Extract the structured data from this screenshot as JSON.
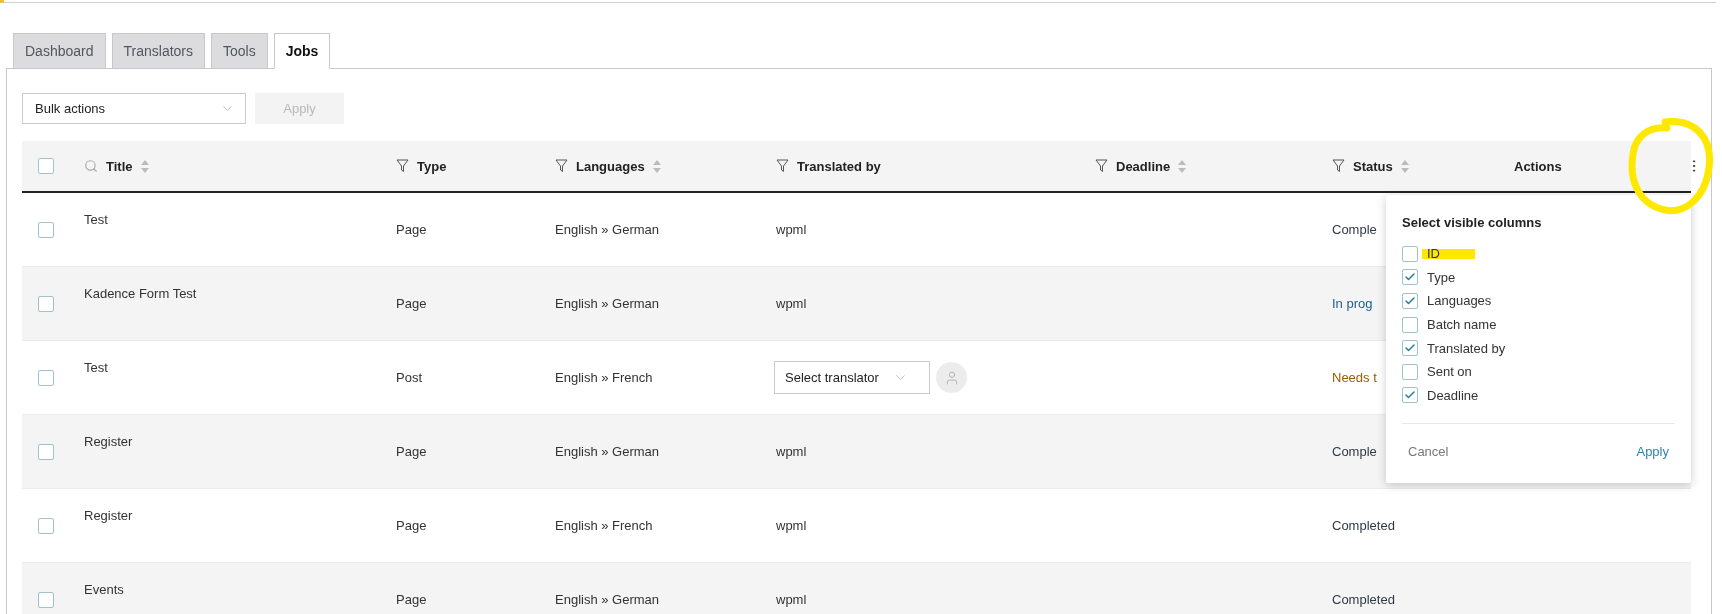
{
  "tabs": [
    {
      "label": "Dashboard",
      "selected": false
    },
    {
      "label": "Translators",
      "selected": false
    },
    {
      "label": "Tools",
      "selected": false
    },
    {
      "label": "Jobs",
      "selected": true
    }
  ],
  "toolbar": {
    "bulk_actions": {
      "value": "Bulk actions"
    },
    "apply_button": {
      "label": "Apply",
      "disabled": true
    }
  },
  "table": {
    "select_all_checked": false,
    "columns": [
      {
        "label": "Title",
        "kind": "search",
        "sortable": true
      },
      {
        "label": "Type",
        "kind": "filter",
        "sortable": false
      },
      {
        "label": "Languages",
        "kind": "filter",
        "sortable": true
      },
      {
        "label": "Translated by",
        "kind": "filter",
        "sortable": false
      },
      {
        "label": "Deadline",
        "kind": "filter",
        "sortable": true
      },
      {
        "label": "Status",
        "kind": "filter",
        "sortable": true
      },
      {
        "label": "Actions",
        "kind": "plain",
        "sortable": false
      }
    ],
    "column_menu_button": {
      "annotated": true
    },
    "rows": [
      {
        "checked": false,
        "title": "Test",
        "type": "Page",
        "languages": "English » German",
        "translator": {
          "kind": "text",
          "value": "wpml"
        },
        "status": {
          "text": "Comple",
          "kind": "completed"
        }
      },
      {
        "checked": false,
        "title": "Kadence Form Test",
        "type": "Page",
        "languages": "English » German",
        "translator": {
          "kind": "text",
          "value": "wpml"
        },
        "status": {
          "text": "In prog",
          "kind": "in_progress"
        }
      },
      {
        "checked": false,
        "title": "Test",
        "type": "Post",
        "languages": "English » French",
        "translator": {
          "kind": "select",
          "value": "Select translator"
        },
        "status": {
          "text": "Needs t",
          "kind": "needs_translation"
        }
      },
      {
        "checked": false,
        "title": "Register",
        "type": "Page",
        "languages": "English » German",
        "translator": {
          "kind": "text",
          "value": "wpml"
        },
        "status": {
          "text": "Comple",
          "kind": "completed"
        }
      },
      {
        "checked": false,
        "title": "Register",
        "type": "Page",
        "languages": "English » French",
        "translator": {
          "kind": "text",
          "value": "wpml"
        },
        "status": {
          "text": "Completed",
          "kind": "completed"
        }
      },
      {
        "checked": false,
        "title": "Events",
        "type": "Page",
        "languages": "English » German",
        "translator": {
          "kind": "text",
          "value": "wpml"
        },
        "status": {
          "text": "Completed",
          "kind": "completed"
        }
      }
    ]
  },
  "column_picker": {
    "title": "Select visible columns",
    "options": [
      {
        "label": "ID",
        "checked": false,
        "highlighted": true
      },
      {
        "label": "Type",
        "checked": true,
        "highlighted": false
      },
      {
        "label": "Languages",
        "checked": true,
        "highlighted": false
      },
      {
        "label": "Batch name",
        "checked": false,
        "highlighted": false
      },
      {
        "label": "Translated by",
        "checked": true,
        "highlighted": false
      },
      {
        "label": "Sent on",
        "checked": false,
        "highlighted": false
      },
      {
        "label": "Deadline",
        "checked": true,
        "highlighted": false
      }
    ],
    "cancel": "Cancel",
    "apply": "Apply"
  }
}
